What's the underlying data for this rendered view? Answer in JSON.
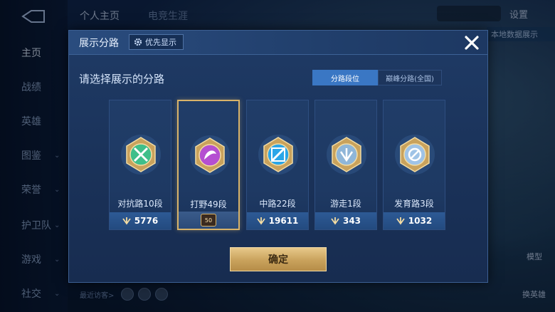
{
  "background": {
    "top_tabs": [
      "个人主页",
      "电竞生涯"
    ],
    "settings_label": "设置",
    "sidebar": [
      {
        "label": "主页",
        "active": true,
        "chevron": false
      },
      {
        "label": "战绩",
        "active": false,
        "chevron": false
      },
      {
        "label": "英雄",
        "active": false,
        "chevron": false
      },
      {
        "label": "图鉴",
        "active": false,
        "chevron": true
      },
      {
        "label": "荣誉",
        "active": false,
        "chevron": true
      },
      {
        "label": "护卫队",
        "active": false,
        "chevron": true
      },
      {
        "label": "游戏",
        "active": false,
        "chevron": true
      },
      {
        "label": "社交",
        "active": false,
        "chevron": true
      }
    ],
    "recent_visitors_label": "最近访客>",
    "side_banner_label": "本地数据展示",
    "right_buttons": [
      "模型",
      "换英雄"
    ]
  },
  "dialog": {
    "title": "展示分路",
    "priority_button_label": "优先显示",
    "subtitle": "请选择展示的分路",
    "segments": [
      {
        "label": "分路段位",
        "active": true
      },
      {
        "label": "巅峰分路(全国)",
        "active": false
      }
    ],
    "cards": [
      {
        "rank": "对抗路10段",
        "score": "5776",
        "selected": false,
        "icon": "top-lane-emblem-icon",
        "color": "#3fbf8a"
      },
      {
        "rank": "打野49段",
        "score": "",
        "selected": true,
        "icon": "jungle-emblem-icon",
        "color": "#b54fd1",
        "level_badge": "50"
      },
      {
        "rank": "中路22段",
        "score": "19611",
        "selected": false,
        "icon": "mid-lane-emblem-icon",
        "color": "#2aa6e8"
      },
      {
        "rank": "游走1段",
        "score": "343",
        "selected": false,
        "icon": "roam-emblem-icon",
        "color": "#8fb6d8"
      },
      {
        "rank": "发育路3段",
        "score": "1032",
        "selected": false,
        "icon": "bot-lane-emblem-icon",
        "color": "#9fc3e6"
      }
    ],
    "confirm_label": "确定"
  },
  "colors": {
    "accent": "#3a77c4",
    "gold": "#d8b36a",
    "panel": "#1f3b66"
  }
}
